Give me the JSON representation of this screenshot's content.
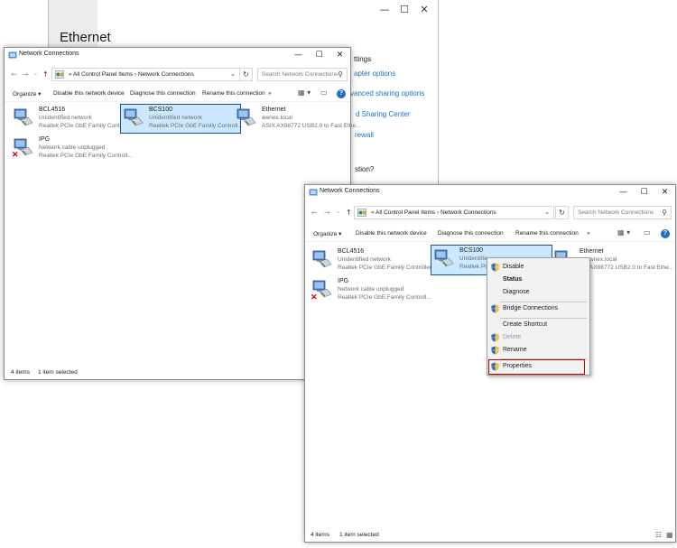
{
  "settings_window": {
    "title": "Ethernet",
    "caption": [
      "—",
      "☐",
      "✕"
    ],
    "links": [
      {
        "text": "ttings"
      },
      {
        "text": "apter options"
      },
      {
        "text": "vanced sharing options"
      },
      {
        "text": "d Sharing Center"
      },
      {
        "text": "rewall"
      },
      {
        "text": "stion?"
      }
    ]
  },
  "window1": {
    "title": "Network Connections",
    "caption": [
      "—",
      "☐",
      "✕"
    ],
    "nav": {
      "back": "←",
      "forward": "→",
      "down": "⌄",
      "up": "↑"
    },
    "address": "«  All Control Panel Items  ›  Network Connections",
    "address_dropdown": "⌄",
    "refresh": "↻",
    "search_placeholder": "Search Network Connections",
    "search_icon": "⚲",
    "commands": [
      "Organize ▾",
      "Disable this network device",
      "Diagnose this connection",
      "Rename this connection",
      "»"
    ],
    "view_icons": [
      "▦ ▾",
      "▭"
    ],
    "help": "?",
    "items": [
      {
        "name": "BCL4516",
        "status": "Unidentified network",
        "device": "Realtek PCIe GbE Family Controller"
      },
      {
        "name": "BCS100",
        "status": "Unidentified network",
        "device": "Realtek PCIe GbE Family Controll..."
      },
      {
        "name": "Ethernet",
        "status": "awnex.local",
        "device": "ASIX AX88772 USB2.0 to Fast Ethe..."
      },
      {
        "name": "IPG",
        "status": "Network cable unplugged",
        "device": "Realtek PCIe GbE Family Controll..."
      }
    ],
    "status": {
      "count": "4 items",
      "selected": "1 item selected"
    }
  },
  "window2": {
    "title": "Network Connections",
    "caption": [
      "—",
      "☐",
      "✕"
    ],
    "nav": {
      "back": "←",
      "forward": "→",
      "down": "⌄",
      "up": "↑"
    },
    "address": "«  All Control Panel Items  ›  Network Connections",
    "address_dropdown": "⌄",
    "refresh": "↻",
    "search_placeholder": "Search Network Connections",
    "search_icon": "⚲",
    "commands": [
      "Organize ▾",
      "Disable this network device",
      "Diagnose this connection",
      "Rename this connection",
      "»"
    ],
    "view_icons": [
      "▦ ▾",
      "▭"
    ],
    "help": "?",
    "items": [
      {
        "name": "BCL4516",
        "status": "Unidentified network",
        "device": "Realtek PCIe GbE Family Controller"
      },
      {
        "name": "BCS100",
        "status": "Unidentifie",
        "device": "Realtek PC"
      },
      {
        "name": "Ethernet",
        "status": "wnex.local",
        "device": "AX88772 USB2.0 to Fast Ethe..."
      },
      {
        "name": "IPG",
        "status": "Network cable unplugged",
        "device": "Realtek PCIe GbE Family Controll..."
      }
    ],
    "status": {
      "count": "4 items",
      "selected": "1 item selected"
    },
    "status_icons": [
      "☷",
      "▦"
    ]
  },
  "context_menu": {
    "items": [
      {
        "label": "Disable",
        "icon": "shield-icon"
      },
      {
        "label": "Status"
      },
      {
        "label": "Diagnose"
      },
      {
        "label": "Bridge Connections",
        "icon": "shield-icon"
      },
      {
        "label": "Create Shortcut"
      },
      {
        "label": "Delete",
        "icon": "shield-icon",
        "disabled": true
      },
      {
        "label": "Rename",
        "icon": "shield-icon"
      },
      {
        "label": "Properties",
        "icon": "shield-icon",
        "highlighted": true
      }
    ]
  },
  "colors": {
    "selection": "#cce8ff",
    "selection_border": "#1a4fa0",
    "link": "#1a6fc0",
    "highlight_box": "#c00000"
  }
}
